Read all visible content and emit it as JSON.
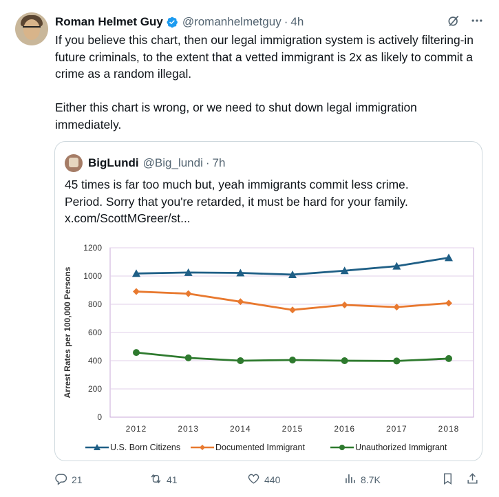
{
  "tweet": {
    "author_name": "Roman Helmet Guy",
    "handle": "@romanhelmetguy",
    "separator": "·",
    "time": "4h",
    "text": "If you believe this chart, then our legal immigration system is actively filtering-in future criminals, to the extent that a vetted immigrant is 2x as likely to commit a crime as a random illegal.\n\nEither this chart is wrong, or we need to shut down legal immigration immediately."
  },
  "quote": {
    "author_name": "BigLundi",
    "handle": "@Big_lundi",
    "separator": "·",
    "time": "7h",
    "lines": [
      "45 times is far too much but, yeah immigrants commit less crime.",
      "Period. Sorry that you're retarded, it must be hard for your family.",
      "x.com/ScottMGreer/st..."
    ]
  },
  "chart_data": {
    "type": "line",
    "title": "",
    "xlabel": "",
    "ylabel": "Arrest Rates per 100,000 Persons",
    "x": [
      "2012",
      "2013",
      "2014",
      "2015",
      "2016",
      "2017",
      "2018"
    ],
    "ylim": [
      0,
      1200
    ],
    "yticks": [
      "0",
      "200",
      "400",
      "600",
      "800",
      "1000",
      "1200"
    ],
    "grid": true,
    "legend_position": "bottom",
    "series": [
      {
        "name": "U.S. Born Citizens",
        "color": "#1f5f86",
        "marker": "triangle",
        "values": [
          1018,
          1025,
          1022,
          1010,
          1038,
          1070,
          1130
        ]
      },
      {
        "name": "Documented Immigrant",
        "color": "#e8792f",
        "marker": "diamond",
        "values": [
          890,
          875,
          818,
          760,
          795,
          780,
          808
        ]
      },
      {
        "name": "Unauthorized Immigrant",
        "color": "#2e7a2e",
        "marker": "circle",
        "values": [
          458,
          420,
          400,
          405,
          400,
          398,
          415
        ]
      }
    ]
  },
  "actions": {
    "replies": "21",
    "reposts": "41",
    "likes": "440",
    "views": "8.7K"
  },
  "icons": [
    "verified-badge-icon",
    "grok-icon",
    "more-icon",
    "reply-icon",
    "repost-icon",
    "like-icon",
    "views-icon",
    "bookmark-icon",
    "share-icon"
  ]
}
